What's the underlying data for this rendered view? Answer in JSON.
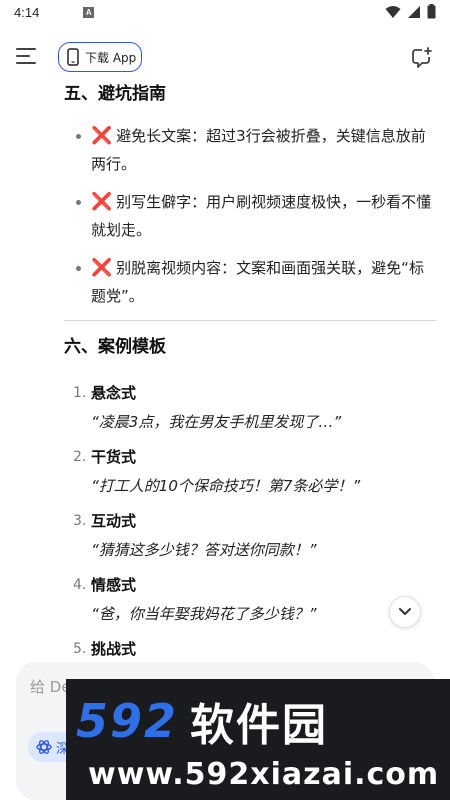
{
  "status_bar": {
    "time": "4:14",
    "a_badge": "A"
  },
  "header": {
    "download_label": "下载 App"
  },
  "section5": {
    "heading": "五、避坑指南",
    "items": [
      {
        "icon": "❌",
        "text": "避免长文案：超过3行会被折叠，关键信息放前两行。"
      },
      {
        "icon": "❌",
        "text": "别写生僻字：用户刷视频速度极快，一秒看不懂就划走。"
      },
      {
        "icon": "❌",
        "text": "别脱离视频内容：文案和画面强关联，避免“标题党”。"
      }
    ]
  },
  "section6": {
    "heading": "六、案例模板",
    "items": [
      {
        "num": "1.",
        "title": "悬念式",
        "quote": "“凌晨3点，我在男友手机里发现了…”"
      },
      {
        "num": "2.",
        "title": "干货式",
        "quote": "“打工人的10个保命技巧！第7条必学！”"
      },
      {
        "num": "3.",
        "title": "互动式",
        "quote": "“猜猜这多少钱？答对送你同款！”"
      },
      {
        "num": "4.",
        "title": "情感式",
        "quote": "“爸，你当年娶我妈花了多少钱？”"
      },
      {
        "num": "5.",
        "title": "挑战式",
        "quote": ""
      }
    ]
  },
  "composer": {
    "placeholder_visible": "给 De",
    "deep_think_label": "深"
  },
  "watermark": {
    "digits": "592",
    "brand": "软件园",
    "url": "www.592xiazai.com"
  },
  "colors": {
    "accent": "#2f5bd6",
    "x_red": "#d32f2f",
    "watermark_bg": "#1a1b1f",
    "watermark_blue": "#2f6fe8"
  }
}
